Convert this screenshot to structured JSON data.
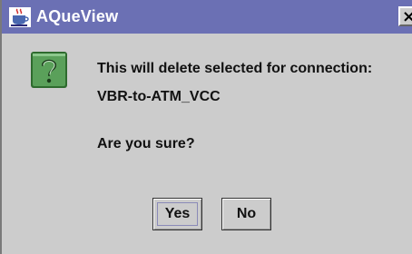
{
  "window": {
    "title": "AQueView",
    "close_glyph": "×",
    "app_icon": "java-cup-icon"
  },
  "message": {
    "icon": "question-icon",
    "line1": "This will delete selected for connection:",
    "line2": "VBR-to-ATM_VCC",
    "question": "Are you sure?"
  },
  "buttons": {
    "yes_label": "Yes",
    "no_label": "No"
  },
  "colors": {
    "titlebar": "#6b70b4",
    "dialog_bg": "#cccccc",
    "question_icon": "#5aa05a"
  }
}
